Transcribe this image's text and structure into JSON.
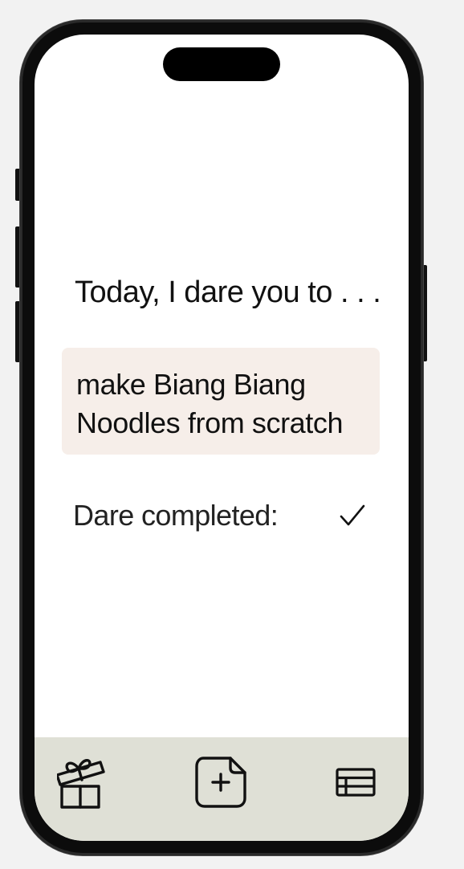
{
  "main": {
    "prompt": "Today, I dare you to . . .",
    "dare": "make Biang Biang Noodles from scratch",
    "completed_label": "Dare completed:",
    "completed": true
  },
  "tabbar": {
    "items": [
      {
        "icon": "gift-icon"
      },
      {
        "icon": "add-document-icon"
      },
      {
        "icon": "list-icon"
      }
    ]
  },
  "colors": {
    "card_bg": "#f6eee9",
    "tabbar_bg": "#dfe0d6",
    "text": "#111111"
  }
}
